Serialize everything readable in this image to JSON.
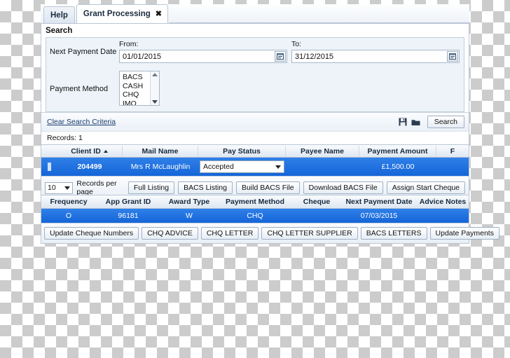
{
  "tabs": [
    {
      "label": "Help",
      "active": false,
      "closable": false
    },
    {
      "label": "Grant Processing",
      "active": true,
      "closable": true,
      "close_glyph": "✖"
    }
  ],
  "search": {
    "title": "Search",
    "next_payment_date_label": "Next Payment Date",
    "from_caption": "From:",
    "from_value": "01/01/2015",
    "to_caption": "To:",
    "to_value": "31/12/2015",
    "payment_method_label": "Payment Method",
    "payment_method_options": [
      "BACS",
      "CASH",
      "CHQ",
      "IMO"
    ],
    "clear_link": "Clear Search Criteria",
    "save_icon": "save-icon",
    "open_icon": "open-folder-icon",
    "search_button": "Search"
  },
  "results": {
    "records_label": "Records:",
    "records_count": "1",
    "columns": [
      "",
      "Client ID",
      "Mail Name",
      "Pay Status",
      "Payee Name",
      "Payment Amount",
      "F"
    ],
    "sorted_column": "Client ID",
    "sort_direction": "asc",
    "row": {
      "client_id": "204499",
      "mail_name": "Mrs R McLaughlin",
      "pay_status": "Accepted",
      "payee_name": "",
      "payment_amount": "£1,500.00",
      "frequency": ""
    }
  },
  "toolbar": {
    "page_size": "10",
    "records_per_page_label": "Records per page",
    "buttons": [
      "Full Listing",
      "BACS Listing",
      "Build BACS File",
      "Download BACS File",
      "Assign Start Cheque"
    ]
  },
  "detail": {
    "columns": [
      "Frequency",
      "App Grant ID",
      "Award Type",
      "Payment Method",
      "Cheque",
      "Next Payment Date",
      "Advice Notes"
    ],
    "row": {
      "frequency": "O",
      "app_grant_id": "96181",
      "award_type": "W",
      "payment_method": "CHQ",
      "cheque": "",
      "next_payment_date": "07/03/2015",
      "advice_notes": ""
    },
    "buttons": [
      "Update Cheque Numbers",
      "CHQ ADVICE",
      "CHQ LETTER",
      "CHQ LETTER SUPPLIER",
      "BACS LETTERS",
      "Update Payments"
    ]
  },
  "colors": {
    "selection_blue": "#1f6fdd",
    "panel_border": "#b9c6d6",
    "link_blue": "#1a3c6e"
  }
}
